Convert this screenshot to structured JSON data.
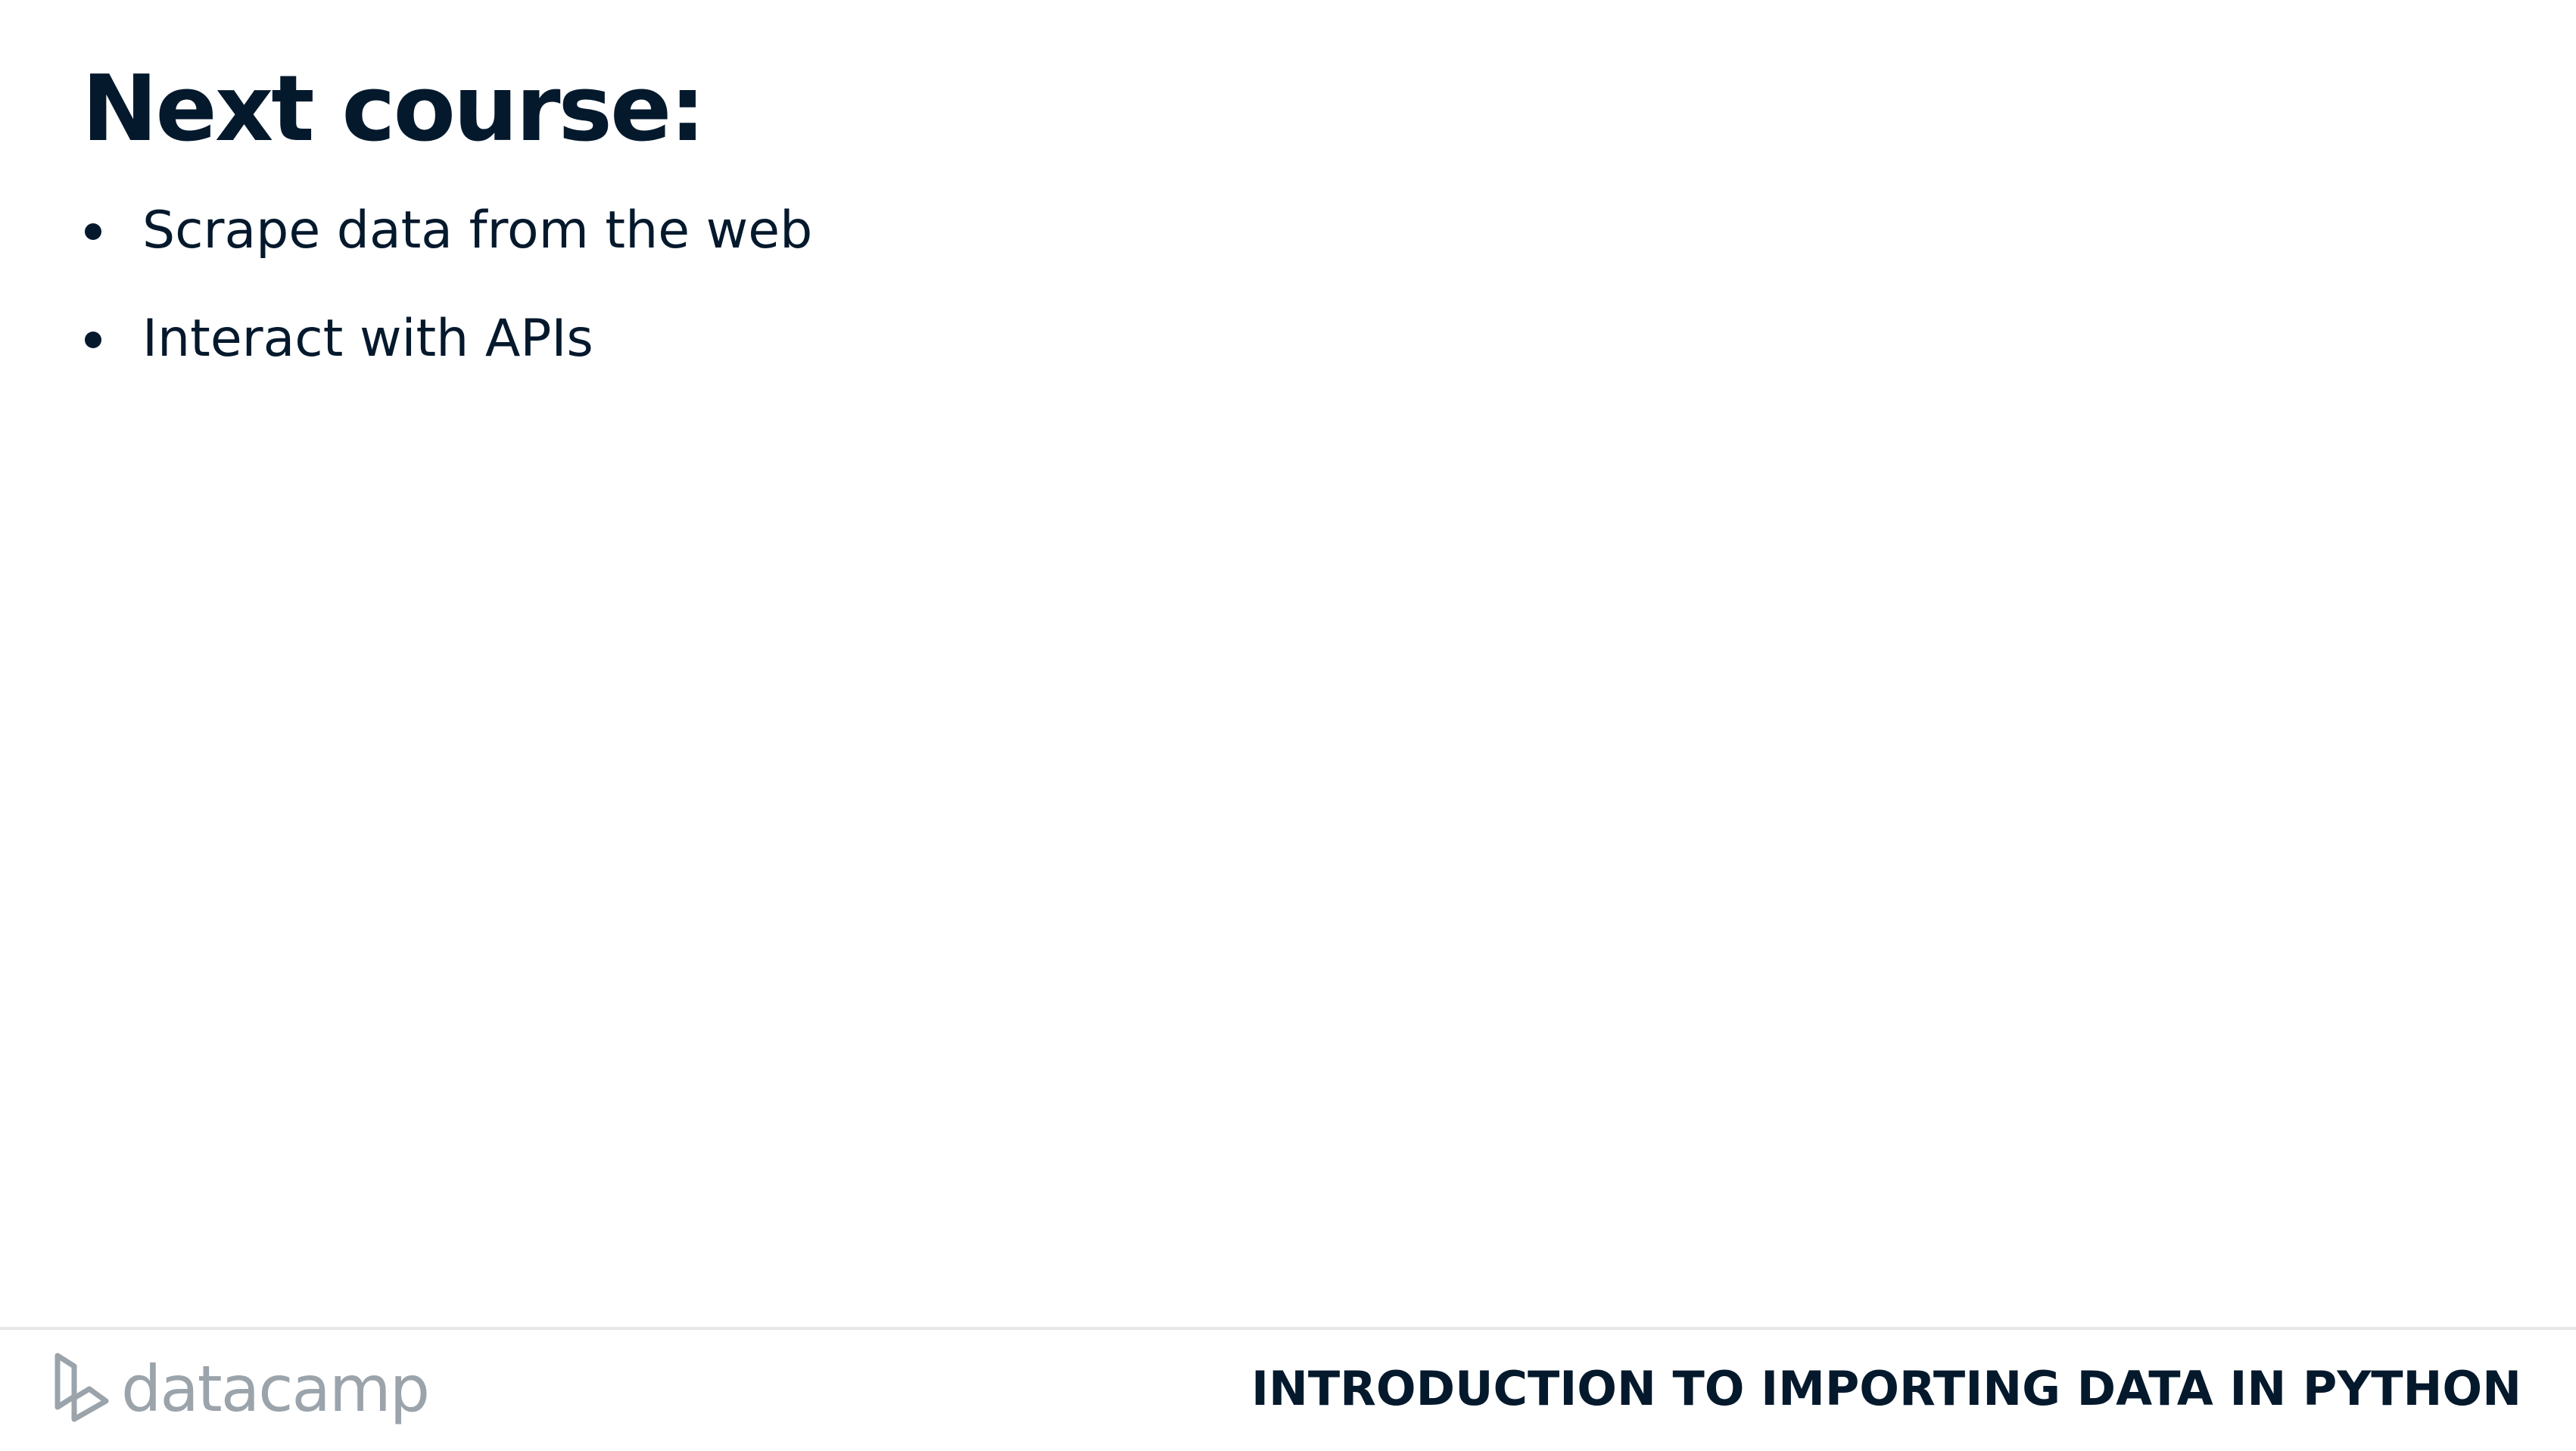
{
  "slide": {
    "title": "Next course:",
    "bullets": [
      "Scrape data from the web",
      "Interact with APIs"
    ]
  },
  "footer": {
    "logo_text": "datacamp",
    "course_name": "INTRODUCTION TO IMPORTING DATA IN PYTHON"
  },
  "colors": {
    "text": "#05192d",
    "logo": "#9ba3ab",
    "divider": "#e5e7ea",
    "background": "#ffffff"
  }
}
